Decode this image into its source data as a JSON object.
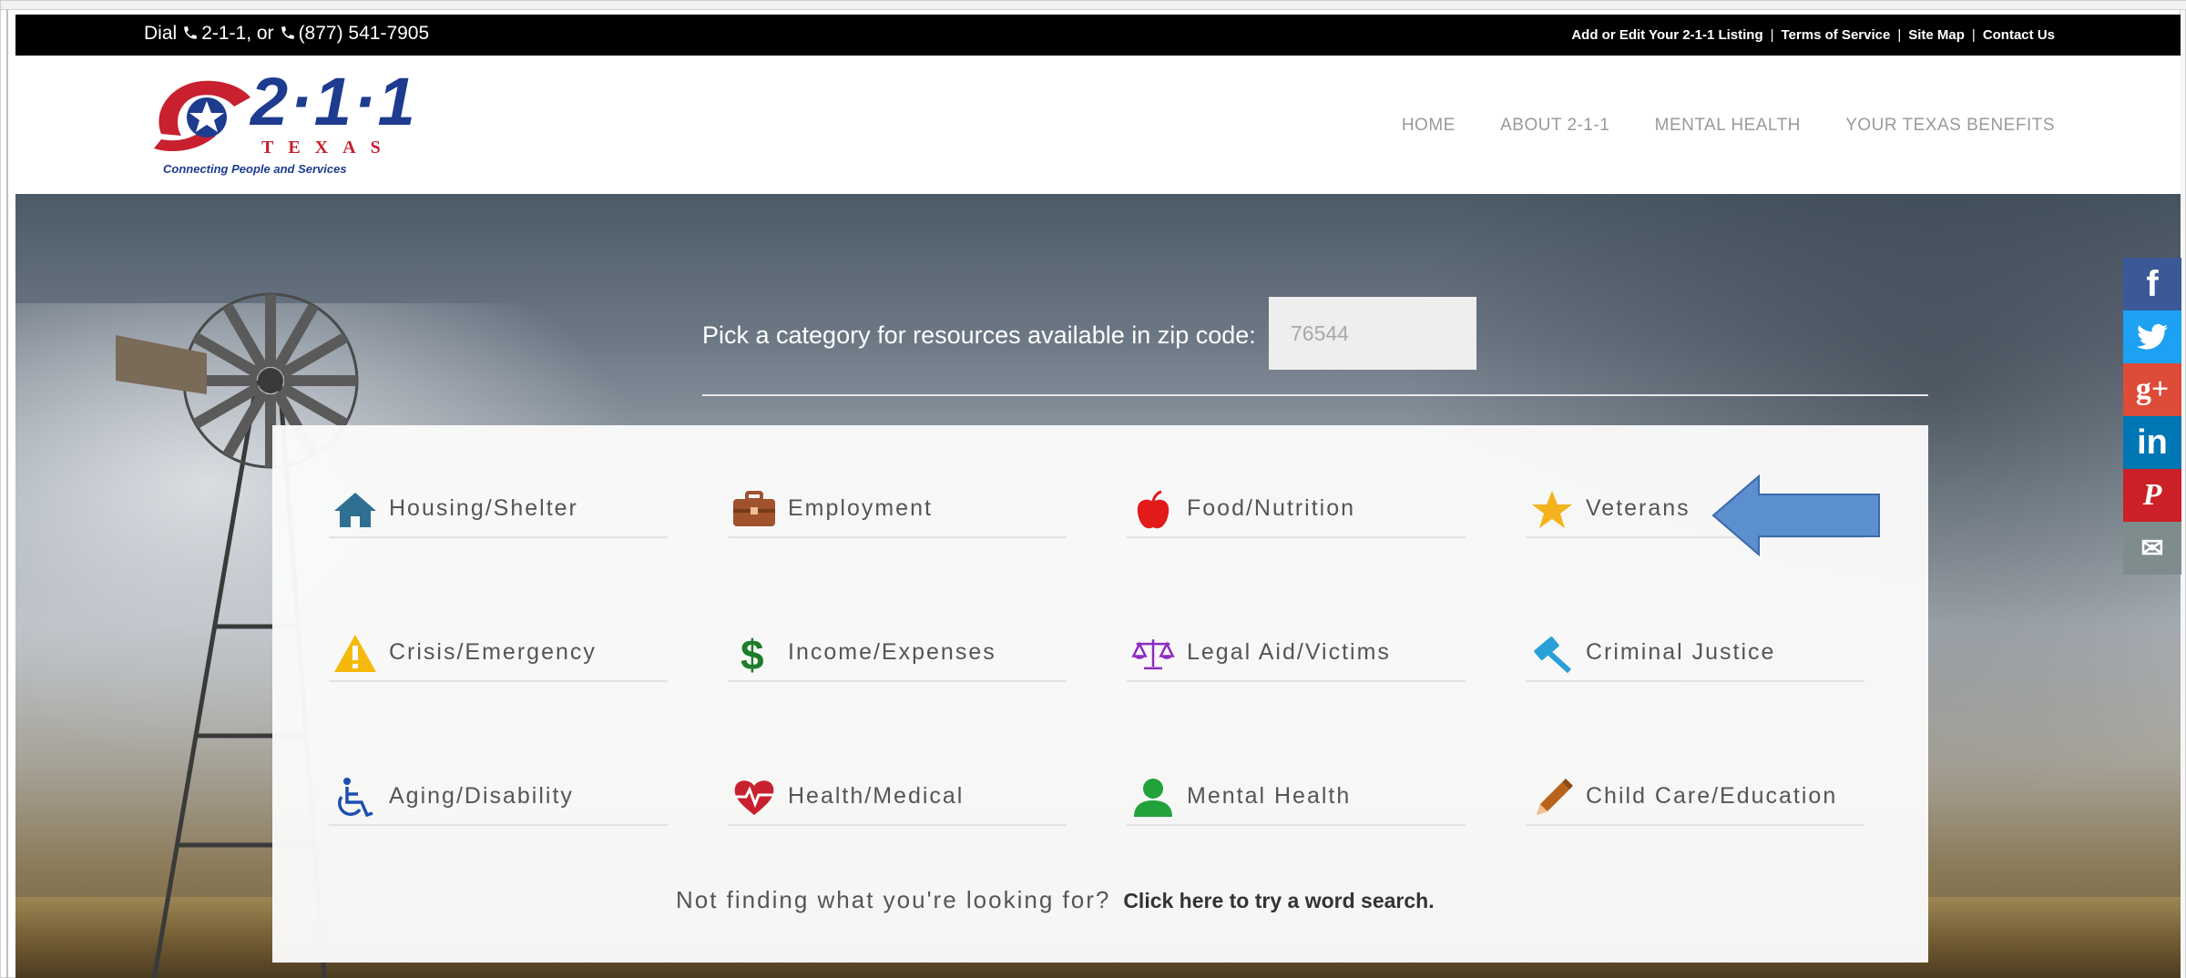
{
  "topbar": {
    "dial_prefix": "Dial",
    "dial_number1": "2-1-1, or",
    "dial_number2": "(877) 541-7905",
    "links": [
      "Add or Edit Your 2-1-1 Listing",
      "Terms of Service",
      "Site Map",
      "Contact Us"
    ],
    "separator": "|"
  },
  "logo": {
    "number": "2·1·1",
    "state": "TEXAS",
    "tagline": "Connecting People and Services"
  },
  "nav": [
    "HOME",
    "ABOUT 2-1-1",
    "MENTAL HEALTH",
    "YOUR TEXAS BENEFITS"
  ],
  "zip": {
    "label": "Pick a category for resources available in zip code:",
    "value": "76544"
  },
  "categories": [
    {
      "label": "Housing/Shelter",
      "icon": "house-icon",
      "color": "#2e6f92"
    },
    {
      "label": "Employment",
      "icon": "briefcase-icon",
      "color": "#a0522d"
    },
    {
      "label": "Food/Nutrition",
      "icon": "apple-icon",
      "color": "#e21a1a"
    },
    {
      "label": "Veterans",
      "icon": "star-icon",
      "color": "#f4b31c"
    },
    {
      "label": "Crisis/Emergency",
      "icon": "warning-icon",
      "color": "#f5b90c"
    },
    {
      "label": "Income/Expenses",
      "icon": "dollar-icon",
      "color": "#1e7d2a"
    },
    {
      "label": "Legal Aid/Victims",
      "icon": "scales-icon",
      "color": "#8e2bbf"
    },
    {
      "label": "Criminal Justice",
      "icon": "gavel-icon",
      "color": "#2aa0d8"
    },
    {
      "label": "Aging/Disability",
      "icon": "wheelchair-icon",
      "color": "#1d4fb0"
    },
    {
      "label": "Health/Medical",
      "icon": "heart-pulse-icon",
      "color": "#c8202f"
    },
    {
      "label": "Mental Health",
      "icon": "person-icon",
      "color": "#22a23a"
    },
    {
      "label": "Child Care/Education",
      "icon": "pencil-icon",
      "color": "#b8621c"
    }
  ],
  "footer_prompt": {
    "question": "Not finding what you're looking for?",
    "link": "Click here to try a word search."
  },
  "social": [
    {
      "icon": "facebook-icon",
      "glyph": "f",
      "color": "#3b5998"
    },
    {
      "icon": "twitter-icon",
      "glyph": "🐦",
      "color": "#1da1f2"
    },
    {
      "icon": "google-plus-icon",
      "glyph": "g+",
      "color": "#dd4b39"
    },
    {
      "icon": "linkedin-icon",
      "glyph": "in",
      "color": "#0077b5"
    },
    {
      "icon": "pinterest-icon",
      "glyph": "P",
      "color": "#cb2027"
    },
    {
      "icon": "email-icon",
      "glyph": "✉",
      "color": "#7f8c8d"
    }
  ]
}
